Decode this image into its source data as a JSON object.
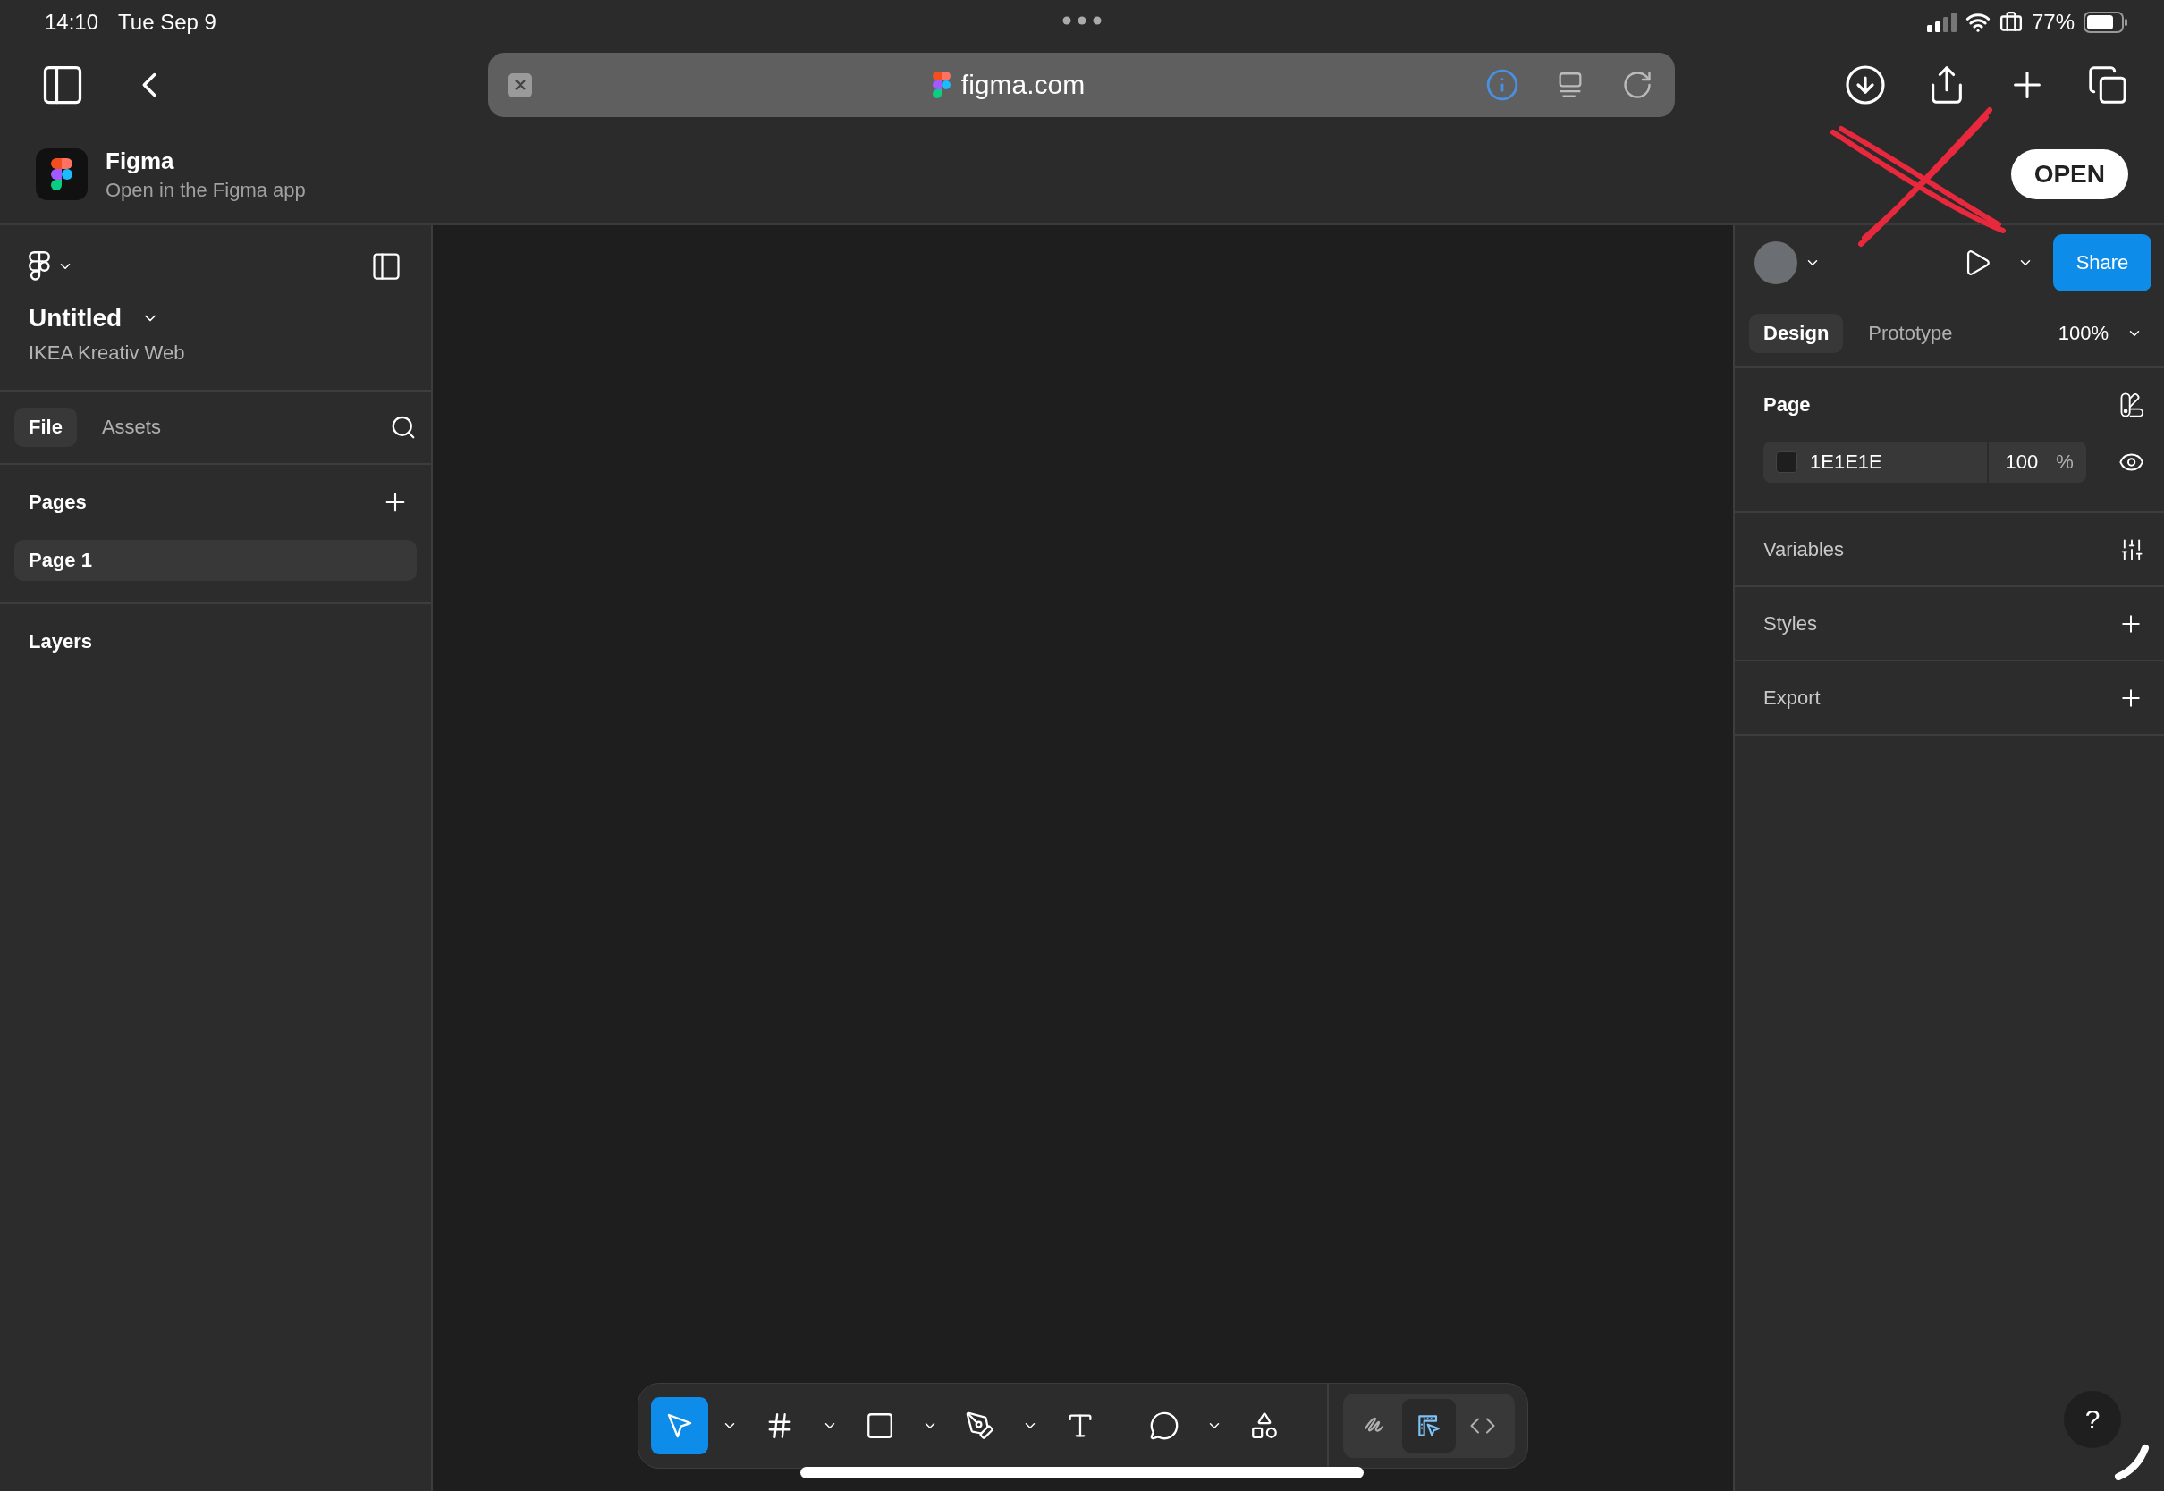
{
  "status_bar": {
    "time": "14:10",
    "date": "Tue Sep 9",
    "battery": "77%"
  },
  "browser": {
    "url": "figma.com"
  },
  "app_banner": {
    "title": "Figma",
    "subtitle": "Open in the Figma app",
    "button": "OPEN"
  },
  "left_panel": {
    "file_title": "Untitled",
    "team": "IKEA Kreativ Web",
    "tabs": [
      {
        "label": "File",
        "selected": true
      },
      {
        "label": "Assets",
        "selected": false
      }
    ],
    "pages_heading": "Pages",
    "pages": [
      {
        "label": "Page 1",
        "selected": true
      }
    ],
    "layers_heading": "Layers"
  },
  "right_panel": {
    "share": "Share",
    "tabs": [
      {
        "label": "Design",
        "selected": true
      },
      {
        "label": "Prototype",
        "selected": false
      }
    ],
    "zoom": "100%",
    "page_section": {
      "title": "Page",
      "color_hex": "1E1E1E",
      "opacity": "100",
      "percent": "%"
    },
    "sections": [
      {
        "label": "Variables",
        "kind": "variables"
      },
      {
        "label": "Styles",
        "kind": "add"
      },
      {
        "label": "Export",
        "kind": "add"
      }
    ],
    "help": "?"
  },
  "toolbar": {
    "tools": [
      {
        "kind": "move",
        "selected": true,
        "has_menu": true
      },
      {
        "kind": "frame",
        "selected": false,
        "has_menu": true
      },
      {
        "kind": "shape",
        "selected": false,
        "has_menu": true
      },
      {
        "kind": "pen",
        "selected": false,
        "has_menu": true
      },
      {
        "kind": "text",
        "selected": false,
        "has_menu": false
      },
      {
        "kind": "comment",
        "selected": false,
        "has_menu": true
      },
      {
        "kind": "actions",
        "selected": false,
        "has_menu": false
      }
    ],
    "modes": [
      {
        "kind": "draw",
        "selected": false
      },
      {
        "kind": "design",
        "selected": true
      },
      {
        "kind": "dev",
        "selected": false
      }
    ]
  }
}
